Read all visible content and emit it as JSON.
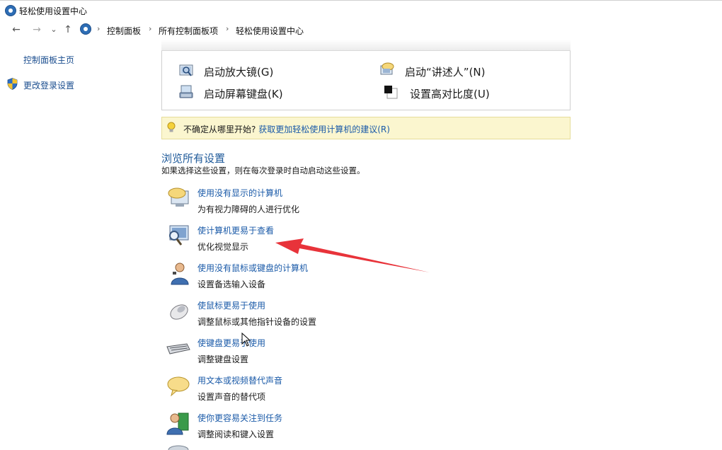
{
  "window": {
    "title": "轻松使用设置中心"
  },
  "nav": {
    "back": "←",
    "forward": "→",
    "history": "⌄",
    "up": "↑"
  },
  "breadcrumb": [
    {
      "label": "控制面板"
    },
    {
      "label": "所有控制面板项"
    },
    {
      "label": "轻松使用设置中心"
    }
  ],
  "sidebar": {
    "items": [
      {
        "label": "控制面板主页"
      },
      {
        "label": "更改登录设置"
      }
    ]
  },
  "quick_access": [
    {
      "label": "启动放大镜(G)",
      "icon": "magnifier-icon"
    },
    {
      "label": "启动屏幕键盘(K)",
      "icon": "keyboard-icon"
    },
    {
      "label": "启动“讲述人”(N)",
      "icon": "narrator-icon"
    },
    {
      "label": "设置高对比度(U)",
      "icon": "contrast-icon"
    }
  ],
  "tip": {
    "text": "不确定从哪里开始?",
    "link": "获取更加轻松使用计算机的建议(R)"
  },
  "section": {
    "title": "浏览所有设置",
    "description": "如果选择这些设置，则在每次登录时自动启动这些设置。",
    "items": [
      {
        "title": "使用没有显示的计算机",
        "desc": "为有视力障碍的人进行优化",
        "icon": "no-display-icon"
      },
      {
        "title": "使计算机更易于查看",
        "desc": "优化视觉显示",
        "icon": "monitor-magnifier-icon"
      },
      {
        "title": "使用没有鼠标或键盘的计算机",
        "desc": "设置备选输入设备",
        "icon": "person-icon"
      },
      {
        "title": "使鼠标更易于使用",
        "desc": "调整鼠标或其他指针设备的设置",
        "icon": "mouse-icon"
      },
      {
        "title": "使键盘更易于使用",
        "desc": "调整键盘设置",
        "icon": "keyboard-icon"
      },
      {
        "title": "用文本或视频替代声音",
        "desc": "设置声音的替代项",
        "icon": "speech-bubble-icon"
      },
      {
        "title": "使你更容易关注到任务",
        "desc": "调整阅读和键入设置",
        "icon": "person-book-icon"
      }
    ]
  },
  "colors": {
    "link": "#1a5aa8",
    "arrow": "#e8333a",
    "tip_bg": "#fbf6cf"
  }
}
